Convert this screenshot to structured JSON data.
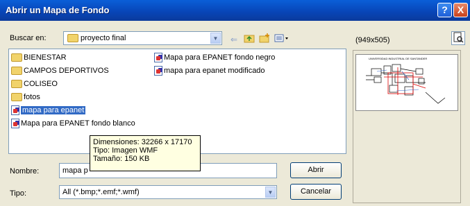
{
  "window": {
    "title": "Abrir un Mapa de Fondo",
    "help_label": "?",
    "close_label": "X"
  },
  "lookin": {
    "label": "Buscar en:",
    "value": "proyecto final"
  },
  "toolbar": {
    "back_icon": "back-arrow-icon",
    "up_icon": "up-folder-icon",
    "new_folder_icon": "new-folder-icon",
    "view_icon": "view-menu-icon"
  },
  "files": [
    {
      "name": "BIENESTAR",
      "type": "folder"
    },
    {
      "name": "CAMPOS DEPORTIVOS",
      "type": "folder"
    },
    {
      "name": "COLISEO",
      "type": "folder"
    },
    {
      "name": "fotos",
      "type": "folder"
    },
    {
      "name": "mapa para epanet",
      "type": "file",
      "selected": true
    },
    {
      "name": "Mapa para EPANET fondo blanco",
      "type": "file"
    },
    {
      "name": "Mapa para EPANET fondo negro",
      "type": "file"
    },
    {
      "name": "mapa para epanet modificado",
      "type": "file"
    }
  ],
  "tooltip": {
    "line1": "Dimensiones: 32266 x 17170",
    "line2": "Tipo: Imagen WMF",
    "line3": "Tamaño: 150 KB"
  },
  "filename": {
    "label": "Nombre:",
    "value": "mapa p"
  },
  "filetype": {
    "label": "Tipo:",
    "value": "All (*.bmp;*.emf;*.wmf)"
  },
  "buttons": {
    "open": "Abrir",
    "cancel": "Cancelar"
  },
  "preview": {
    "size_text": "(949x505)",
    "thumb_title": "UNIVERSIDAD INDUSTRIAL DE SANTANDER"
  }
}
